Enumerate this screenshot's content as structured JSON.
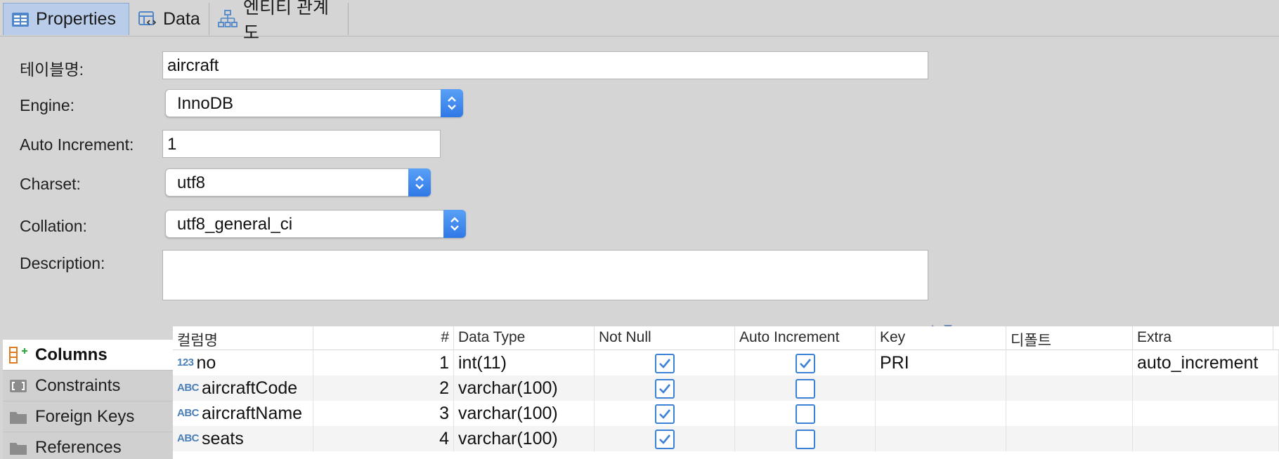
{
  "tabs": [
    {
      "label": "Properties",
      "icon": "properties-icon",
      "active": true
    },
    {
      "label": "Data",
      "icon": "data-icon",
      "active": false
    },
    {
      "label": "엔티티 관계도",
      "icon": "er-diagram-icon",
      "active": false
    }
  ],
  "form": {
    "table_name_label": "테이블명:",
    "table_name_value": "aircraft",
    "engine_label": "Engine:",
    "engine_value": "InnoDB",
    "auto_increment_label": "Auto Increment:",
    "auto_increment_value": "1",
    "charset_label": "Charset:",
    "charset_value": "utf8",
    "collation_label": "Collation:",
    "collation_value": "utf8_general_ci",
    "description_label": "Description:",
    "description_value": ""
  },
  "side_tabs": [
    {
      "label": "Columns",
      "icon": "columns-icon",
      "active": true
    },
    {
      "label": "Constraints",
      "icon": "constraints-icon",
      "active": false
    },
    {
      "label": "Foreign Keys",
      "icon": "folder-icon",
      "active": false
    },
    {
      "label": "References",
      "icon": "folder-icon",
      "active": false
    }
  ],
  "columns_table": {
    "headers": [
      "컬럼명",
      "#",
      "Data Type",
      "Not Null",
      "Auto Increment",
      "Key",
      "디폴트",
      "Extra"
    ],
    "rows": [
      {
        "type_icon": "123",
        "name": "no",
        "num": "1",
        "data_type": "int(11)",
        "not_null": true,
        "auto_increment": true,
        "key": "PRI",
        "default": "",
        "extra": "auto_increment"
      },
      {
        "type_icon": "ABC",
        "name": "aircraftCode",
        "num": "2",
        "data_type": "varchar(100)",
        "not_null": true,
        "auto_increment": false,
        "key": "",
        "default": "",
        "extra": ""
      },
      {
        "type_icon": "ABC",
        "name": "aircraftName",
        "num": "3",
        "data_type": "varchar(100)",
        "not_null": true,
        "auto_increment": false,
        "key": "",
        "default": "",
        "extra": ""
      },
      {
        "type_icon": "ABC",
        "name": "seats",
        "num": "4",
        "data_type": "varchar(100)",
        "not_null": true,
        "auto_increment": false,
        "key": "",
        "default": "",
        "extra": ""
      }
    ]
  },
  "colors": {
    "accent": "#3b82d6",
    "tab_active": "#b9cdea",
    "panel_bg": "#d5d5d5"
  }
}
